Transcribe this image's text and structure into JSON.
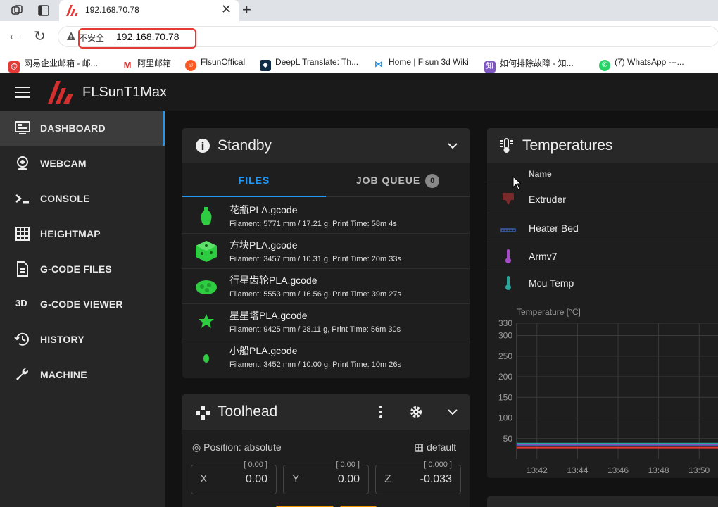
{
  "browser": {
    "tab_title": "192.168.70.78",
    "insecure_label": "不安全",
    "url": "192.168.70.78",
    "bookmarks": [
      {
        "label": "网易企业邮箱 - 邮...",
        "icon": "mail-icon",
        "color": "#e53935"
      },
      {
        "label": "阿里邮箱",
        "icon": "aliyun-mail-icon",
        "color": "#d32f2f"
      },
      {
        "label": "FlsunOffical",
        "icon": "reddit-icon",
        "color": "#ff5722"
      },
      {
        "label": "DeepL Translate: Th...",
        "icon": "deepl-icon",
        "color": "#0f2b46"
      },
      {
        "label": "Home | Flsun 3d Wiki",
        "icon": "wiki-icon",
        "color": "#1e88e5"
      },
      {
        "label": "如何排除故障 - 知...",
        "icon": "zhihu-icon",
        "color": "#7e57c2"
      },
      {
        "label": "(7) WhatsApp ---...",
        "icon": "whatsapp-icon",
        "color": "#25d366"
      }
    ]
  },
  "app": {
    "title": "FLSunT1Max",
    "nav": [
      {
        "label": "DASHBOARD",
        "icon": "dashboard-icon"
      },
      {
        "label": "WEBCAM",
        "icon": "webcam-icon"
      },
      {
        "label": "CONSOLE",
        "icon": "console-icon"
      },
      {
        "label": "HEIGHTMAP",
        "icon": "grid-icon"
      },
      {
        "label": "G-CODE FILES",
        "icon": "file-icon"
      },
      {
        "label": "G-CODE VIEWER",
        "icon": "3d-icon"
      },
      {
        "label": "HISTORY",
        "icon": "history-icon"
      },
      {
        "label": "MACHINE",
        "icon": "wrench-icon"
      }
    ],
    "icon_3d_text": "3D"
  },
  "status": {
    "title": "Standby",
    "tab_files": "FILES",
    "tab_queue": "JOB QUEUE",
    "queue_count": "0",
    "files": [
      {
        "name": "花瓶PLA.gcode",
        "meta": "Filament: 5771 mm / 17.21 g, Print Time: 58m 4s"
      },
      {
        "name": "方块PLA.gcode",
        "meta": "Filament: 3457 mm / 10.31 g, Print Time: 20m 33s"
      },
      {
        "name": "行星齿轮PLA.gcode",
        "meta": "Filament: 5553 mm / 16.56 g, Print Time: 39m 27s"
      },
      {
        "name": "星星塔PLA.gcode",
        "meta": "Filament: 9425 mm / 28.11 g, Print Time: 56m 30s"
      },
      {
        "name": "小船PLA.gcode",
        "meta": "Filament: 3452 mm / 10.00 g, Print Time: 10m 26s"
      }
    ]
  },
  "toolhead": {
    "title": "Toolhead",
    "position_label": "Position: absolute",
    "profile_label": "default",
    "axes": [
      {
        "axis": "X",
        "limit": "[ 0.00 ]",
        "value": "0.00"
      },
      {
        "axis": "Y",
        "limit": "[ 0.00 ]",
        "value": "0.00"
      },
      {
        "axis": "Z",
        "limit": "[ 0.000 ]",
        "value": "-0.033"
      }
    ]
  },
  "temperatures": {
    "title": "Temperatures",
    "col_name": "Name",
    "rows": [
      {
        "name": "Extruder",
        "icon": "extruder-icon",
        "color": "#7a2a2a"
      },
      {
        "name": "Heater Bed",
        "icon": "heater-bed-icon",
        "color": "#3a5fa8"
      },
      {
        "name": "Armv7",
        "icon": "thermometer-icon",
        "color": "#a64ac9"
      },
      {
        "name": "Mcu Temp",
        "icon": "thermometer-icon",
        "color": "#26a69a"
      }
    ]
  },
  "chart_data": {
    "type": "line",
    "title": "Temperature [°C]",
    "xlabel": "",
    "ylabel": "Temperature [°C]",
    "x_ticks": [
      "13:42",
      "13:44",
      "13:46",
      "13:48",
      "13:50"
    ],
    "y_ticks": [
      50,
      100,
      150,
      200,
      250,
      300,
      330
    ],
    "ylim": [
      0,
      330
    ],
    "x": [
      "13:41",
      "13:42",
      "13:43",
      "13:44",
      "13:45",
      "13:46",
      "13:47",
      "13:48",
      "13:49",
      "13:50",
      "13:51"
    ],
    "series": [
      {
        "color": "#26a69a",
        "values": [
          38,
          38,
          38,
          38,
          38,
          38,
          38,
          38,
          38,
          38,
          38
        ]
      },
      {
        "color": "#a64ac9",
        "values": [
          36,
          36,
          36,
          36,
          36,
          36,
          36,
          36,
          36,
          36,
          36
        ]
      },
      {
        "color": "#3a5fa8",
        "values": [
          33,
          33,
          33,
          33,
          33,
          33,
          33,
          33,
          33,
          33,
          33
        ]
      },
      {
        "color": "#e53935",
        "values": [
          28,
          28,
          28,
          28,
          28,
          28,
          28,
          28,
          28,
          28,
          28
        ]
      }
    ],
    "grid": true
  }
}
